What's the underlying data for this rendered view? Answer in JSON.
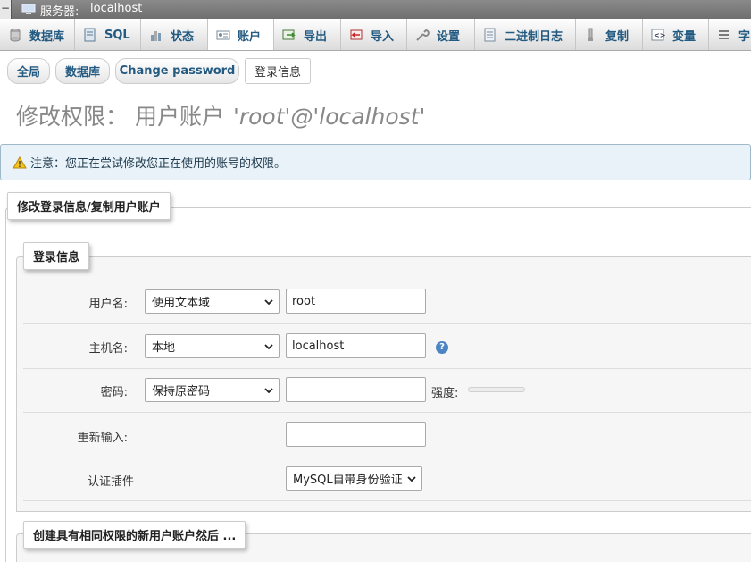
{
  "server_bar": {
    "label": "服务器:",
    "server_name": "localhost",
    "collapse_symbol": "−"
  },
  "menu": {
    "tabs": [
      {
        "label": "数据库",
        "icon": "database-icon"
      },
      {
        "label": "SQL",
        "icon": "sql-icon"
      },
      {
        "label": "状态",
        "icon": "status-icon"
      },
      {
        "label": "账户",
        "icon": "accounts-icon",
        "active": true
      },
      {
        "label": "导出",
        "icon": "export-icon"
      },
      {
        "label": "导入",
        "icon": "import-icon"
      },
      {
        "label": "设置",
        "icon": "settings-wrench-icon"
      },
      {
        "label": "二进制日志",
        "icon": "binary-log-icon"
      },
      {
        "label": "复制",
        "icon": "replication-icon"
      },
      {
        "label": "变量",
        "icon": "variables-icon"
      },
      {
        "label": "字",
        "icon": "charset-icon"
      }
    ]
  },
  "subtabs": [
    {
      "label": "全局"
    },
    {
      "label": "数据库"
    },
    {
      "label": "Change password"
    },
    {
      "label": "登录信息",
      "active": true
    }
  ],
  "page": {
    "title_prefix": "修改权限：  用户账户",
    "account": "'root'@'localhost'"
  },
  "notice": {
    "text": "注意：您正在尝试修改您正在使用的账号的权限。"
  },
  "fieldset_outer": {
    "legend": "修改登录信息/复制用户账户"
  },
  "login_info": {
    "legend": "登录信息",
    "username": {
      "label": "用户名:",
      "mode": "使用文本域",
      "value": "root"
    },
    "host": {
      "label": "主机名:",
      "mode": "本地",
      "value": "localhost",
      "help": "?"
    },
    "password": {
      "label": "密码:",
      "mode": "保持原密码",
      "value": "",
      "strength_label": "强度:"
    },
    "retype": {
      "label": "重新输入:",
      "value": ""
    },
    "auth_plugin": {
      "label": "认证插件",
      "value": "MySQL自带身份验证"
    }
  },
  "create_new": {
    "legend": "创建具有相同权限的新用户账户然后 ..."
  },
  "colors": {
    "link_blue": "#235a81",
    "notice_bg": "#e8f2f8",
    "warning_yellow": "#f4c21b"
  }
}
